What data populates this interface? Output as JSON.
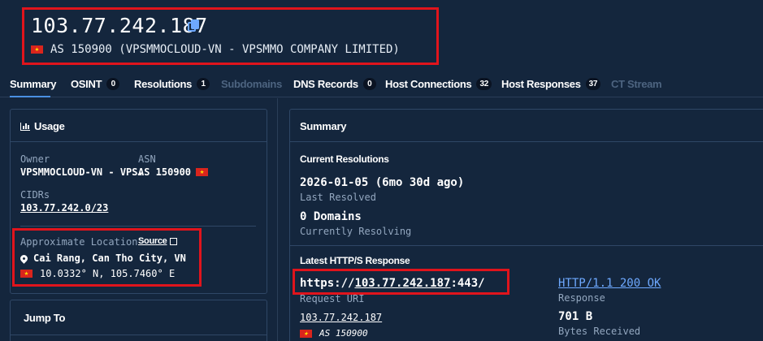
{
  "header": {
    "ip": "103.77.242.187",
    "as_text": "AS 150900 (VPSMMOCLOUD-VN - VPSMMO COMPANY LIMITED)"
  },
  "tabs": [
    {
      "label": "Summary",
      "count": null,
      "active": true,
      "disabled": false
    },
    {
      "label": "OSINT",
      "count": "0",
      "disabled": false
    },
    {
      "label": "Resolutions",
      "count": "1",
      "disabled": false
    },
    {
      "label": "Subdomains",
      "count": null,
      "disabled": true
    },
    {
      "label": "DNS Records",
      "count": "0",
      "disabled": false
    },
    {
      "label": "Host Connections",
      "count": "32",
      "disabled": false
    },
    {
      "label": "Host Responses",
      "count": "37",
      "disabled": false
    },
    {
      "label": "CT Stream",
      "count": null,
      "disabled": true
    }
  ],
  "usage": {
    "title": "Usage",
    "owner_label": "Owner",
    "owner_value": "VPSMMOCLOUD-VN - VPS…",
    "asn_label": "ASN",
    "asn_value": "AS 150900",
    "cidrs_label": "CIDRs",
    "cidr_value": "103.77.242.0/23",
    "location_label": "Approximate Location",
    "source_label": "Source",
    "location_city": "Cai Rang, Can Tho City, VN",
    "location_coords": "10.0332° N, 105.7460° E"
  },
  "jump_to": {
    "title": "Jump To"
  },
  "summary": {
    "title": "Summary",
    "current_resolutions_title": "Current Resolutions",
    "last_resolved_value": "2026-01-05 (6mo 30d ago)",
    "last_resolved_label": "Last Resolved",
    "domains_value": "0 Domains",
    "domains_label": "Currently Resolving",
    "latest_response_title": "Latest HTTP/S Response",
    "request_uri_prefix": "https://",
    "request_uri_host": "103.77.242.187",
    "request_uri_suffix": ":443/",
    "request_uri_label": "Request URI",
    "response_value": "HTTP/1.1 200 OK",
    "response_label": "Response",
    "host_ip": "103.77.242.187",
    "host_as": "AS 150900",
    "bytes_value": "701 B",
    "bytes_label": "Bytes Received"
  },
  "colors": {
    "background": "#14263d",
    "highlight_box": "#e0141c",
    "accent": "#4a90e2",
    "link": "#6ea9ff"
  }
}
